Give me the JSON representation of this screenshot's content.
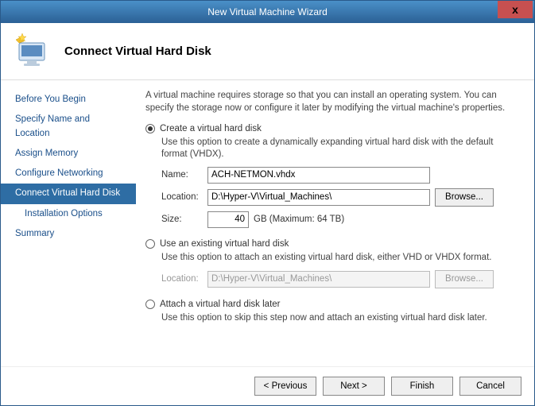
{
  "window": {
    "title": "New Virtual Machine Wizard",
    "close": "x"
  },
  "header": {
    "title": "Connect Virtual Hard Disk"
  },
  "sidebar": {
    "items": [
      {
        "label": "Before You Begin"
      },
      {
        "label": "Specify Name and Location"
      },
      {
        "label": "Assign Memory"
      },
      {
        "label": "Configure Networking"
      },
      {
        "label": "Connect Virtual Hard Disk"
      },
      {
        "label": "Installation Options"
      },
      {
        "label": "Summary"
      }
    ]
  },
  "main": {
    "intro": "A virtual machine requires storage so that you can install an operating system. You can specify the storage now or configure it later by modifying the virtual machine's properties.",
    "option1": {
      "label": "Create a virtual hard disk",
      "desc": "Use this option to create a dynamically expanding virtual hard disk with the default format (VHDX).",
      "name_label": "Name:",
      "name_value": "ACH-NETMON.vhdx",
      "location_label": "Location:",
      "location_value": "D:\\Hyper-V\\Virtual_Machines\\",
      "browse_label": "Browse...",
      "size_label": "Size:",
      "size_value": "40",
      "size_suffix": "GB (Maximum: 64 TB)"
    },
    "option2": {
      "label": "Use an existing virtual hard disk",
      "desc": "Use this option to attach an existing virtual hard disk, either VHD or VHDX format.",
      "location_label": "Location:",
      "location_value": "D:\\Hyper-V\\Virtual_Machines\\",
      "browse_label": "Browse..."
    },
    "option3": {
      "label": "Attach a virtual hard disk later",
      "desc": "Use this option to skip this step now and attach an existing virtual hard disk later."
    }
  },
  "footer": {
    "previous": "< Previous",
    "next": "Next >",
    "finish": "Finish",
    "cancel": "Cancel"
  }
}
